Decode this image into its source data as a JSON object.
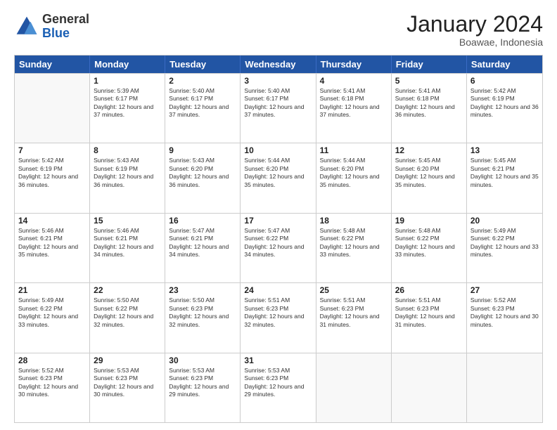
{
  "header": {
    "logo_line1": "General",
    "logo_line2": "Blue",
    "month_title": "January 2024",
    "location": "Boawae, Indonesia"
  },
  "weekdays": [
    "Sunday",
    "Monday",
    "Tuesday",
    "Wednesday",
    "Thursday",
    "Friday",
    "Saturday"
  ],
  "rows": [
    [
      {
        "day": "",
        "sunrise": "",
        "sunset": "",
        "daylight": ""
      },
      {
        "day": "1",
        "sunrise": "Sunrise: 5:39 AM",
        "sunset": "Sunset: 6:17 PM",
        "daylight": "Daylight: 12 hours and 37 minutes."
      },
      {
        "day": "2",
        "sunrise": "Sunrise: 5:40 AM",
        "sunset": "Sunset: 6:17 PM",
        "daylight": "Daylight: 12 hours and 37 minutes."
      },
      {
        "day": "3",
        "sunrise": "Sunrise: 5:40 AM",
        "sunset": "Sunset: 6:17 PM",
        "daylight": "Daylight: 12 hours and 37 minutes."
      },
      {
        "day": "4",
        "sunrise": "Sunrise: 5:41 AM",
        "sunset": "Sunset: 6:18 PM",
        "daylight": "Daylight: 12 hours and 37 minutes."
      },
      {
        "day": "5",
        "sunrise": "Sunrise: 5:41 AM",
        "sunset": "Sunset: 6:18 PM",
        "daylight": "Daylight: 12 hours and 36 minutes."
      },
      {
        "day": "6",
        "sunrise": "Sunrise: 5:42 AM",
        "sunset": "Sunset: 6:19 PM",
        "daylight": "Daylight: 12 hours and 36 minutes."
      }
    ],
    [
      {
        "day": "7",
        "sunrise": "Sunrise: 5:42 AM",
        "sunset": "Sunset: 6:19 PM",
        "daylight": "Daylight: 12 hours and 36 minutes."
      },
      {
        "day": "8",
        "sunrise": "Sunrise: 5:43 AM",
        "sunset": "Sunset: 6:19 PM",
        "daylight": "Daylight: 12 hours and 36 minutes."
      },
      {
        "day": "9",
        "sunrise": "Sunrise: 5:43 AM",
        "sunset": "Sunset: 6:20 PM",
        "daylight": "Daylight: 12 hours and 36 minutes."
      },
      {
        "day": "10",
        "sunrise": "Sunrise: 5:44 AM",
        "sunset": "Sunset: 6:20 PM",
        "daylight": "Daylight: 12 hours and 35 minutes."
      },
      {
        "day": "11",
        "sunrise": "Sunrise: 5:44 AM",
        "sunset": "Sunset: 6:20 PM",
        "daylight": "Daylight: 12 hours and 35 minutes."
      },
      {
        "day": "12",
        "sunrise": "Sunrise: 5:45 AM",
        "sunset": "Sunset: 6:20 PM",
        "daylight": "Daylight: 12 hours and 35 minutes."
      },
      {
        "day": "13",
        "sunrise": "Sunrise: 5:45 AM",
        "sunset": "Sunset: 6:21 PM",
        "daylight": "Daylight: 12 hours and 35 minutes."
      }
    ],
    [
      {
        "day": "14",
        "sunrise": "Sunrise: 5:46 AM",
        "sunset": "Sunset: 6:21 PM",
        "daylight": "Daylight: 12 hours and 35 minutes."
      },
      {
        "day": "15",
        "sunrise": "Sunrise: 5:46 AM",
        "sunset": "Sunset: 6:21 PM",
        "daylight": "Daylight: 12 hours and 34 minutes."
      },
      {
        "day": "16",
        "sunrise": "Sunrise: 5:47 AM",
        "sunset": "Sunset: 6:21 PM",
        "daylight": "Daylight: 12 hours and 34 minutes."
      },
      {
        "day": "17",
        "sunrise": "Sunrise: 5:47 AM",
        "sunset": "Sunset: 6:22 PM",
        "daylight": "Daylight: 12 hours and 34 minutes."
      },
      {
        "day": "18",
        "sunrise": "Sunrise: 5:48 AM",
        "sunset": "Sunset: 6:22 PM",
        "daylight": "Daylight: 12 hours and 33 minutes."
      },
      {
        "day": "19",
        "sunrise": "Sunrise: 5:48 AM",
        "sunset": "Sunset: 6:22 PM",
        "daylight": "Daylight: 12 hours and 33 minutes."
      },
      {
        "day": "20",
        "sunrise": "Sunrise: 5:49 AM",
        "sunset": "Sunset: 6:22 PM",
        "daylight": "Daylight: 12 hours and 33 minutes."
      }
    ],
    [
      {
        "day": "21",
        "sunrise": "Sunrise: 5:49 AM",
        "sunset": "Sunset: 6:22 PM",
        "daylight": "Daylight: 12 hours and 33 minutes."
      },
      {
        "day": "22",
        "sunrise": "Sunrise: 5:50 AM",
        "sunset": "Sunset: 6:22 PM",
        "daylight": "Daylight: 12 hours and 32 minutes."
      },
      {
        "day": "23",
        "sunrise": "Sunrise: 5:50 AM",
        "sunset": "Sunset: 6:23 PM",
        "daylight": "Daylight: 12 hours and 32 minutes."
      },
      {
        "day": "24",
        "sunrise": "Sunrise: 5:51 AM",
        "sunset": "Sunset: 6:23 PM",
        "daylight": "Daylight: 12 hours and 32 minutes."
      },
      {
        "day": "25",
        "sunrise": "Sunrise: 5:51 AM",
        "sunset": "Sunset: 6:23 PM",
        "daylight": "Daylight: 12 hours and 31 minutes."
      },
      {
        "day": "26",
        "sunrise": "Sunrise: 5:51 AM",
        "sunset": "Sunset: 6:23 PM",
        "daylight": "Daylight: 12 hours and 31 minutes."
      },
      {
        "day": "27",
        "sunrise": "Sunrise: 5:52 AM",
        "sunset": "Sunset: 6:23 PM",
        "daylight": "Daylight: 12 hours and 30 minutes."
      }
    ],
    [
      {
        "day": "28",
        "sunrise": "Sunrise: 5:52 AM",
        "sunset": "Sunset: 6:23 PM",
        "daylight": "Daylight: 12 hours and 30 minutes."
      },
      {
        "day": "29",
        "sunrise": "Sunrise: 5:53 AM",
        "sunset": "Sunset: 6:23 PM",
        "daylight": "Daylight: 12 hours and 30 minutes."
      },
      {
        "day": "30",
        "sunrise": "Sunrise: 5:53 AM",
        "sunset": "Sunset: 6:23 PM",
        "daylight": "Daylight: 12 hours and 29 minutes."
      },
      {
        "day": "31",
        "sunrise": "Sunrise: 5:53 AM",
        "sunset": "Sunset: 6:23 PM",
        "daylight": "Daylight: 12 hours and 29 minutes."
      },
      {
        "day": "",
        "sunrise": "",
        "sunset": "",
        "daylight": ""
      },
      {
        "day": "",
        "sunrise": "",
        "sunset": "",
        "daylight": ""
      },
      {
        "day": "",
        "sunrise": "",
        "sunset": "",
        "daylight": ""
      }
    ]
  ]
}
